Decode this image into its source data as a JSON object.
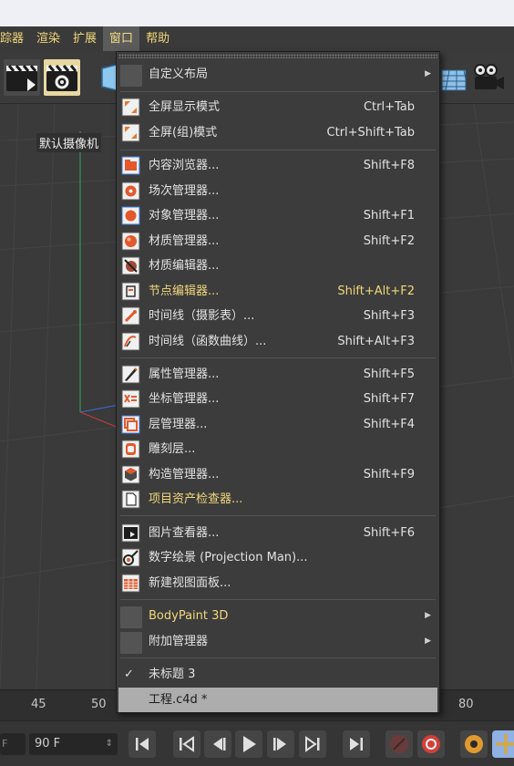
{
  "menubar": {
    "items": [
      {
        "label": "踪器"
      },
      {
        "label": "渲染"
      },
      {
        "label": "扩展"
      },
      {
        "label": "窗口"
      },
      {
        "label": "帮助"
      }
    ]
  },
  "viewport": {
    "camera_label": "默认摄像机"
  },
  "ruler": {
    "ticks": [
      "45",
      "50",
      "80"
    ]
  },
  "transport": {
    "frame_left": "F",
    "frame_value": "90 F"
  },
  "window_menu": {
    "custom_layout": {
      "label": "自定义布局"
    },
    "fullscreen": {
      "label": "全屏显示模式",
      "shortcut": "Ctrl+Tab"
    },
    "fullscreen_group": {
      "label": "全屏(组)模式",
      "shortcut": "Ctrl+Shift+Tab"
    },
    "content_browser": {
      "label": "内容浏览器...",
      "shortcut": "Shift+F8"
    },
    "take_manager": {
      "label": "场次管理器..."
    },
    "object_manager": {
      "label": "对象管理器...",
      "shortcut": "Shift+F1"
    },
    "material_manager": {
      "label": "材质管理器...",
      "shortcut": "Shift+F2"
    },
    "material_editor": {
      "label": "材质编辑器..."
    },
    "node_editor": {
      "label": "节点编辑器...",
      "shortcut": "Shift+Alt+F2"
    },
    "timeline_dopesheet": {
      "label": "时间线（摄影表）...",
      "shortcut": "Shift+F3"
    },
    "timeline_fcurve": {
      "label": "时间线（函数曲线）...",
      "shortcut": "Shift+Alt+F3"
    },
    "attribute_manager": {
      "label": "属性管理器...",
      "shortcut": "Shift+F5"
    },
    "coordinate_manager": {
      "label": "坐标管理器...",
      "shortcut": "Shift+F7"
    },
    "layer_manager": {
      "label": "层管理器...",
      "shortcut": "Shift+F4"
    },
    "sculpt_layers": {
      "label": "雕刻层..."
    },
    "structure_manager": {
      "label": "构造管理器...",
      "shortcut": "Shift+F9"
    },
    "project_asset_inspector": {
      "label": "项目资产检查器..."
    },
    "picture_viewer": {
      "label": "图片查看器...",
      "shortcut": "Shift+F6"
    },
    "projection_man": {
      "label": "数字绘景 (Projection Man)..."
    },
    "new_view_panel": {
      "label": "新建视图面板..."
    },
    "bodypaint": {
      "label": "BodyPaint 3D"
    },
    "additional_managers": {
      "label": "附加管理器"
    },
    "doc_untitled": {
      "label": "未标题 3"
    },
    "doc_project": {
      "label": "工程.c4d *"
    }
  },
  "colors": {
    "accent_yellow": "#f0d77a",
    "menu_bg": "#3c3c3c",
    "selected_row": "#adadad"
  }
}
